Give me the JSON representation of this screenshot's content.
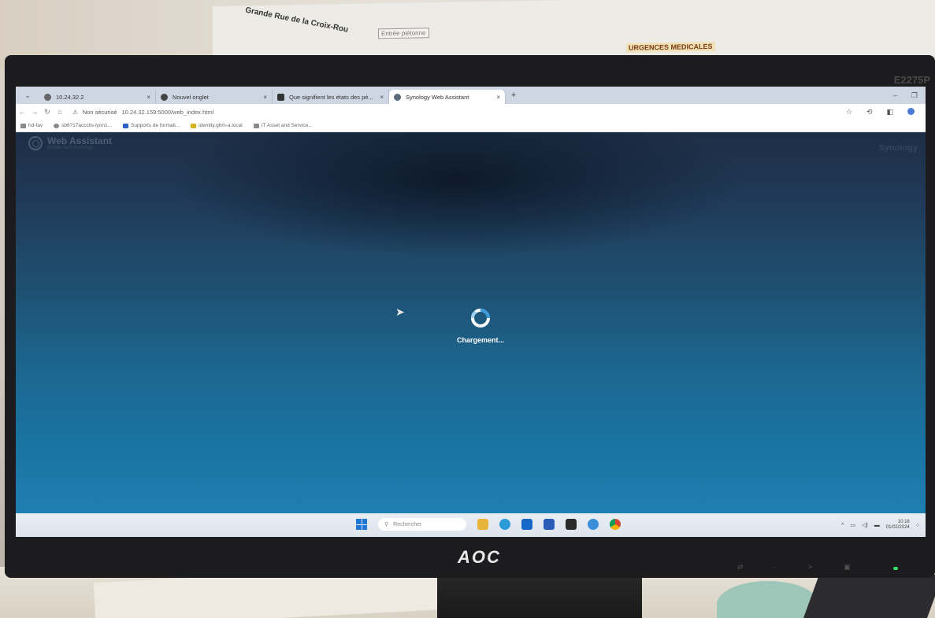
{
  "environment": {
    "wall_sign": "Grande Rue de la Croix-Rou",
    "plan_box": "Entrée piétonne",
    "plan_urgences": "URGENCES MEDICALES",
    "monitor_brand": "AOC",
    "monitor_model": "E2275P"
  },
  "browser": {
    "tabs": [
      {
        "label": "10.24.32.2",
        "active": false
      },
      {
        "label": "Nouvel onglet",
        "active": false
      },
      {
        "label": "Que signifient les états des pé...",
        "active": false
      },
      {
        "label": "Synology Web Assistant",
        "active": true
      }
    ],
    "new_tab_symbol": "+",
    "address": {
      "security_label": "Non sécurisé",
      "url": "10.24.32.159:5000/web_index.html"
    },
    "bookmarks": [
      {
        "label": "hd-fav"
      },
      {
        "label": "sb6?17accclis-lyon1..."
      },
      {
        "label": "Supports de formati..."
      },
      {
        "label": "identity.ghm-a.local"
      },
      {
        "label": "IT Asset and Service..."
      }
    ]
  },
  "page": {
    "logo_title": "Web Assistant",
    "logo_subtitle": "Mobile Tech Synology",
    "right_brand": "Synology",
    "loading_text": "Chargement..."
  },
  "taskbar": {
    "search_placeholder": "Rechercher",
    "clock_time": "10:16",
    "clock_date": "01/02/2024"
  },
  "colors": {
    "page_top": "#1e2e46",
    "page_bottom": "#1f7fb0",
    "spinner_ring": "#ffffff",
    "spinner_accent": "#3a9ad9",
    "power_led": "#2fe06a"
  }
}
